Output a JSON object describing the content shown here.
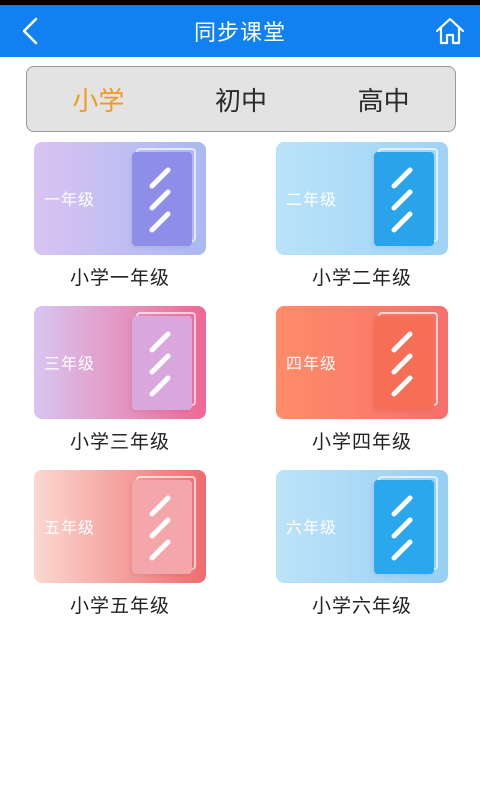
{
  "header": {
    "title": "同步课堂",
    "back_icon": "chevron-left-icon",
    "home_icon": "home-icon"
  },
  "tabs": [
    {
      "label": "小学",
      "active": true
    },
    {
      "label": "初中",
      "active": false
    },
    {
      "label": "高中",
      "active": false
    }
  ],
  "grades": [
    {
      "banner": "一年级",
      "caption": "小学一年级"
    },
    {
      "banner": "二年级",
      "caption": "小学二年级"
    },
    {
      "banner": "三年级",
      "caption": "小学三年级"
    },
    {
      "banner": "四年级",
      "caption": "小学四年级"
    },
    {
      "banner": "五年级",
      "caption": "小学五年级"
    },
    {
      "banner": "六年级",
      "caption": "小学六年级"
    }
  ],
  "colors": {
    "header_bg": "#1180f0",
    "active_tab": "#f09a1e",
    "segment_bg": "#e3e3e3"
  }
}
